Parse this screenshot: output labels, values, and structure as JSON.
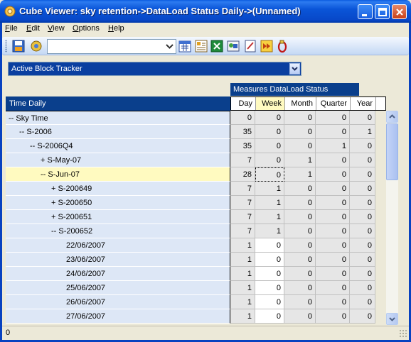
{
  "window": {
    "title": "Cube Viewer: sky retention->DataLoad Status Daily->(Unnamed)"
  },
  "menu": [
    {
      "first": "F",
      "rest": "ile"
    },
    {
      "first": "E",
      "rest": "dit"
    },
    {
      "first": "V",
      "rest": "iew"
    },
    {
      "first": "O",
      "rest": "ptions"
    },
    {
      "first": "H",
      "rest": "elp"
    }
  ],
  "toolbar": {
    "subset_value": ""
  },
  "tracker": {
    "selected": "Active Block Tracker"
  },
  "grid": {
    "measure_title": "Measures DataLoad Status",
    "row_dim_title": "Time Daily",
    "columns": [
      "Day",
      "Week",
      "Month",
      "Quarter",
      "Year"
    ],
    "rows": [
      {
        "label": "-- Sky Time",
        "indent": 0,
        "values": [
          "0",
          "0",
          "0",
          "0",
          "0"
        ]
      },
      {
        "label": "-- S-2006",
        "indent": 1,
        "values": [
          "35",
          "0",
          "0",
          "0",
          "1"
        ]
      },
      {
        "label": "-- S-2006Q4",
        "indent": 2,
        "values": [
          "35",
          "0",
          "0",
          "1",
          "0"
        ]
      },
      {
        "label": "+ S-May-07",
        "indent": 3,
        "values": [
          "7",
          "0",
          "1",
          "0",
          "0"
        ]
      },
      {
        "label": "-- S-Jun-07",
        "indent": 3,
        "values": [
          "28",
          "0",
          "1",
          "0",
          "0"
        ],
        "selected": true
      },
      {
        "label": "+ S-200649",
        "indent": 4,
        "values": [
          "7",
          "1",
          "0",
          "0",
          "0"
        ]
      },
      {
        "label": "+ S-200650",
        "indent": 4,
        "values": [
          "7",
          "1",
          "0",
          "0",
          "0"
        ]
      },
      {
        "label": "+ S-200651",
        "indent": 4,
        "values": [
          "7",
          "1",
          "0",
          "0",
          "0"
        ]
      },
      {
        "label": "-- S-200652",
        "indent": 4,
        "values": [
          "7",
          "1",
          "0",
          "0",
          "0"
        ]
      },
      {
        "label": "22/06/2007",
        "indent": 5,
        "values": [
          "1",
          "0",
          "0",
          "0",
          "0"
        ]
      },
      {
        "label": "23/06/2007",
        "indent": 5,
        "values": [
          "1",
          "0",
          "0",
          "0",
          "0"
        ]
      },
      {
        "label": "24/06/2007",
        "indent": 5,
        "values": [
          "1",
          "0",
          "0",
          "0",
          "0"
        ]
      },
      {
        "label": "25/06/2007",
        "indent": 5,
        "values": [
          "1",
          "0",
          "0",
          "0",
          "0"
        ]
      },
      {
        "label": "26/06/2007",
        "indent": 5,
        "values": [
          "1",
          "0",
          "0",
          "0",
          "0"
        ]
      },
      {
        "label": "27/06/2007",
        "indent": 5,
        "values": [
          "1",
          "0",
          "0",
          "0",
          "0"
        ]
      }
    ]
  },
  "status": {
    "text": "0"
  },
  "icons": [
    "cube-icon",
    "minimize-icon",
    "maximize-icon",
    "close-icon",
    "save-icon",
    "recalc-icon",
    "chevron-down-icon",
    "calendar-icon",
    "view-icon",
    "excel-icon",
    "subset-icon",
    "edit-icon",
    "forward-icon",
    "sandbox-icon"
  ],
  "colors": {
    "titlebar": "#0a55d8",
    "header": "#0a3f8c",
    "row_label_bg": "#dde7f6",
    "selected_row": "#fffac0"
  }
}
